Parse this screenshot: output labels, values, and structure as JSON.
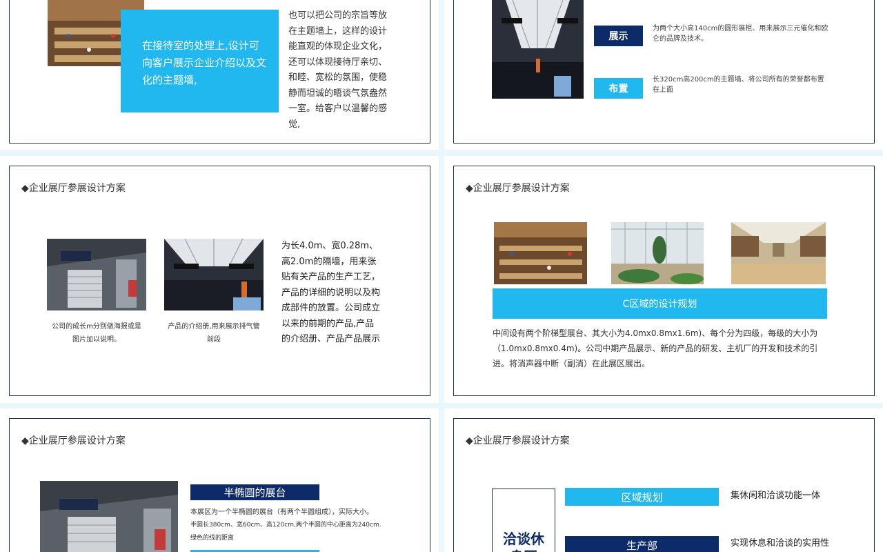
{
  "colors": {
    "accent_blue": "#21b8ef",
    "navy": "#0d2a69",
    "frame": "#24344f",
    "bg": "#e9f6fc"
  },
  "slide1": {
    "blue_box": "在接待室的处理上,设计可向客户展示企业介绍以及文化的主题墙,",
    "body": "也可以把公司的宗旨等放在主题墙上，这样的设计能直观的体现企业文化，还可以体现接待厅亲切、和睦、宽松的氛围，使稳静而坦诚的晤谈气氛盎然一室。给客户以温馨的感觉,"
  },
  "slide2": {
    "items": [
      {
        "label": "展示",
        "text": "为两个大小高140cm的圆形展柜、用来展示三元催化和欧仑的品牌及技术。"
      },
      {
        "label": "布置",
        "text": "长320cm高200cm的主题墙、将公司所有的荣誉都布置在上面"
      }
    ]
  },
  "slide3": {
    "title": "◆企业展厅参展设计方案",
    "caption1": "公司的成长m分别做海报或是图片加以说明。",
    "caption2": "产品的介绍册,用来展示排气管前段",
    "body": "为长4.0m、宽0.28m、高2.0m的隔墙，用来张贴有关产品的生产工艺，产品的详细的说明以及构成部件的放置。公司成立以来的前期的产品,产品的介绍册、产品产品展示"
  },
  "slide4": {
    "title": "◆企业展厅参展设计方案",
    "banner": "C区域的设计规划",
    "body": "中间设有两个阶梯型展台、其大小为4.0mx0.8mx1.6m)、每个分为四级，每级的大小为（1.0mx0.8mx0.4m)。公司中期产品展示、新的产品的研发、主机厂的开发和技术的引进。将消声器中断（副消）在此展区展出。"
  },
  "slide5": {
    "title": "◆企业展厅参展设计方案",
    "heading": "半椭圆的展台",
    "line1": "本展区为一个半椭圆的展台（有两个半圆组成），实际大小。",
    "line2": "半圆长380cm、宽60cm、高120cm,两个半圆的中心距离为240cm.",
    "line3": "绿色的线的距离"
  },
  "slide6": {
    "title": "◆企业展厅参展设计方案",
    "box_text": "洽谈休息区",
    "rows": [
      {
        "label": "区域规划",
        "text": "集休闲和洽谈功能一体"
      },
      {
        "label": "生产部",
        "text": "实现休息和洽谈的实用性"
      }
    ]
  }
}
